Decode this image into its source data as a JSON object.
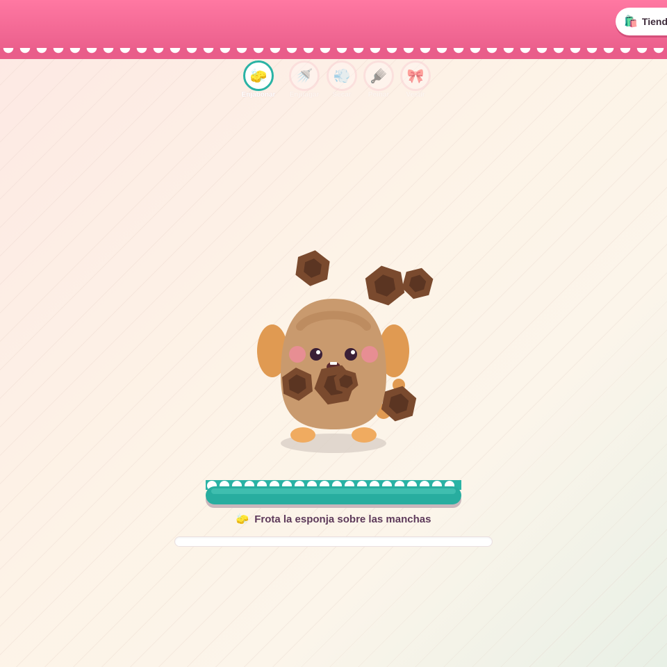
{
  "header": {
    "shop_label": "Tienda",
    "shop_icon": "shopping-bag-icon"
  },
  "tools": [
    {
      "id": "sponge",
      "label": "Enjabonar",
      "icon": "sponge-icon",
      "glyph": "🧽",
      "active": true
    },
    {
      "id": "shower",
      "label": "Enjuagar",
      "icon": "shower-icon",
      "glyph": "🚿",
      "active": false
    },
    {
      "id": "dryer",
      "label": "Secar",
      "icon": "dryer-icon",
      "glyph": "💨",
      "active": false
    },
    {
      "id": "brush",
      "label": "Peinar",
      "icon": "brush-icon",
      "glyph": "🪮",
      "active": false
    },
    {
      "id": "bow",
      "label": "Vestir",
      "icon": "bow-icon",
      "glyph": "🎀",
      "active": false
    }
  ],
  "instruction": {
    "icon": "sponge-icon",
    "text": "Frota la esponja sobre las manchas"
  },
  "progress": {
    "value": 0
  },
  "colors": {
    "header": "#e95d8a",
    "accent": "#2ab3a5",
    "pet_body": "#c99a6e",
    "pet_ears": "#e09a52",
    "dirt": "#6b4430"
  }
}
